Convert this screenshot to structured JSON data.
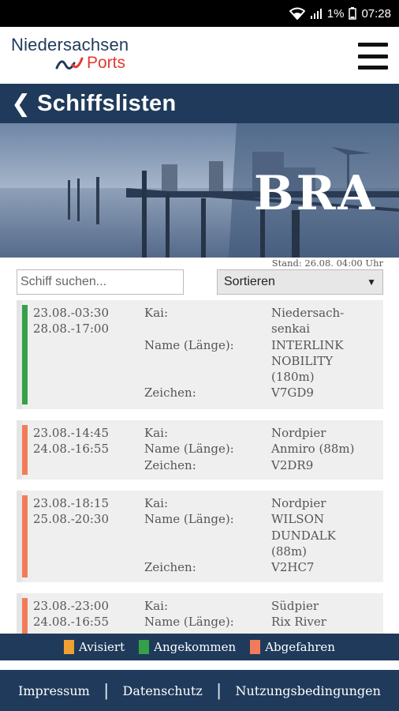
{
  "status_bar": {
    "battery": "1%",
    "time": "07:28"
  },
  "brand": {
    "line1": "Niedersachsen",
    "line2": "Ports",
    "accent_color": "#e23a2f",
    "primary_color": "#1f3a5a"
  },
  "page": {
    "title": "Schiffslisten",
    "port_code": "BRA",
    "stand": "Stand: 26.08. 04:00 Uhr"
  },
  "search": {
    "placeholder": "Schiff suchen...",
    "value": ""
  },
  "sort": {
    "selected": "Sortieren"
  },
  "labels": {
    "kai": "Kai:",
    "name": "Name (Länge):",
    "zeichen": "Zeichen:"
  },
  "ships": [
    {
      "status": "angekommen",
      "date_from": "23.08.-03:30",
      "date_to": "28.08.-17:00",
      "kai": [
        "Niedersach-",
        "senkai"
      ],
      "name": [
        "INTERLINK",
        "NOBILITY",
        "(180m)"
      ],
      "zeichen": "V7GD9"
    },
    {
      "status": "abgefahren",
      "date_from": "23.08.-14:45",
      "date_to": "24.08.-16:55",
      "kai": [
        "Nordpier"
      ],
      "name": [
        "Anmiro (88m)"
      ],
      "zeichen": "V2DR9"
    },
    {
      "status": "abgefahren",
      "date_from": "23.08.-18:15",
      "date_to": "25.08.-20:30",
      "kai": [
        "Nordpier"
      ],
      "name": [
        "WILSON",
        "DUNDALK",
        "(88m)"
      ],
      "zeichen": "V2HC7"
    },
    {
      "status": "abgefahren",
      "date_from": "23.08.-23:00",
      "date_to": "24.08.-16:55",
      "kai": [
        "Südpier"
      ],
      "name": [
        "Rix River"
      ],
      "zeichen": ""
    }
  ],
  "legend": [
    {
      "label": "Avisiert",
      "color": "#f0a033"
    },
    {
      "label": "Angekommen",
      "color": "#34a047"
    },
    {
      "label": "Abgefahren",
      "color": "#f27c5a"
    }
  ],
  "status_colors": {
    "avisiert": "#f0a033",
    "angekommen": "#34a047",
    "abgefahren": "#f27c5a"
  },
  "footer": {
    "impressum": "Impressum",
    "datenschutz": "Datenschutz",
    "nutzung": "Nutzungsbedingungen"
  }
}
